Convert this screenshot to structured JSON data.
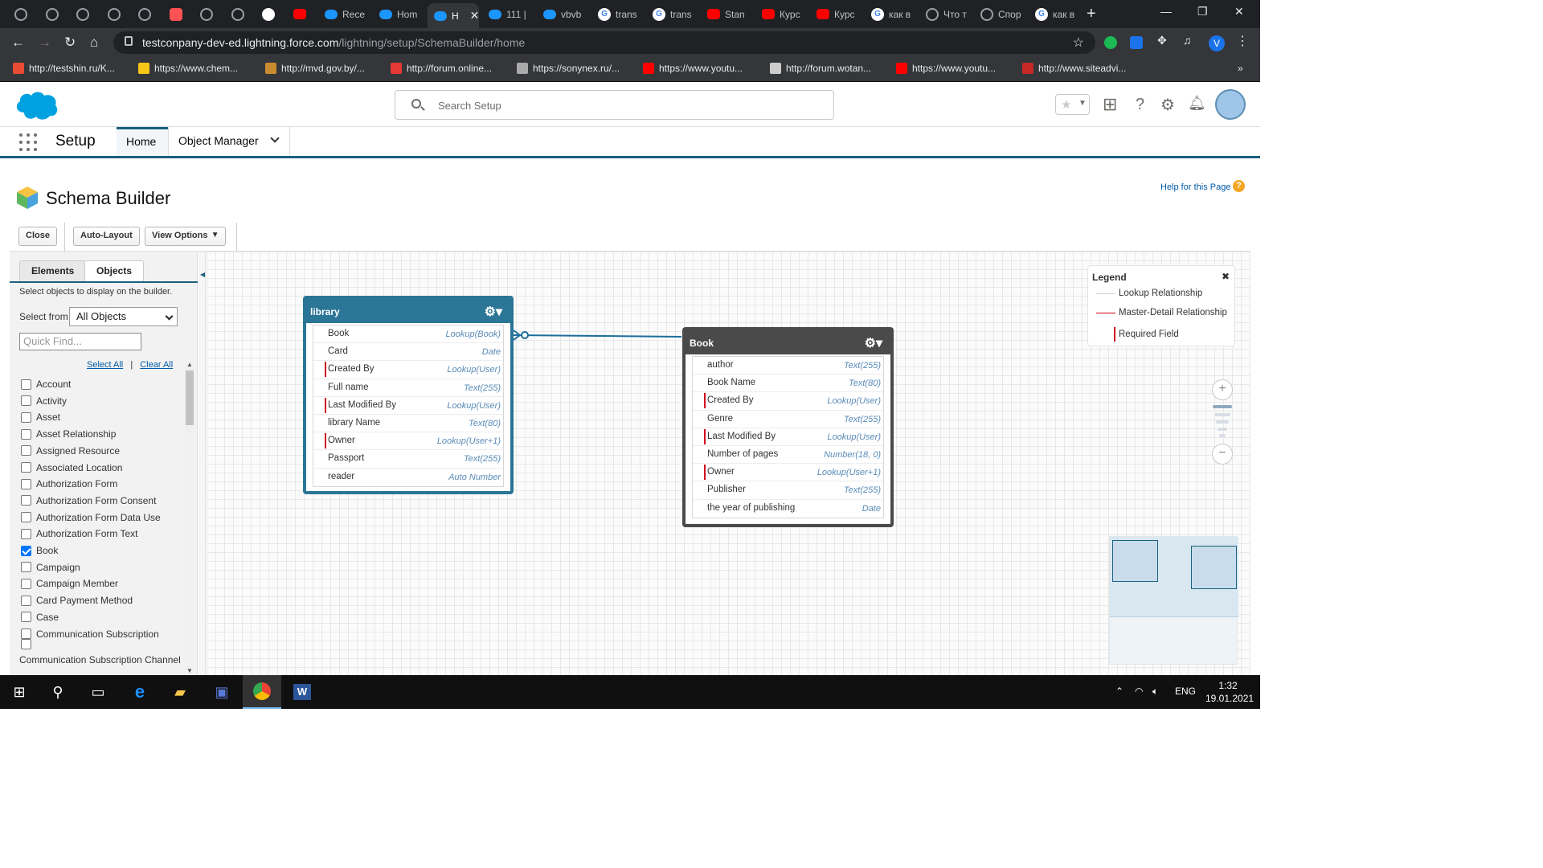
{
  "browser": {
    "tabs": [
      {
        "label": "",
        "icon": "globe-icon"
      },
      {
        "label": "",
        "icon": "globe-icon"
      },
      {
        "label": "",
        "icon": "globe-icon"
      },
      {
        "label": "",
        "icon": "globe-icon"
      },
      {
        "label": "",
        "icon": "globe-icon"
      },
      {
        "label": "",
        "icon": "chat-icon"
      },
      {
        "label": "",
        "icon": "globe-icon"
      },
      {
        "label": "",
        "icon": "globe-icon"
      },
      {
        "label": "",
        "icon": "github-icon"
      },
      {
        "label": "",
        "icon": "youtube-icon"
      },
      {
        "label": "Rece",
        "icon": "salesforce-icon"
      },
      {
        "label": "Hom",
        "icon": "salesforce-icon"
      },
      {
        "label": "H",
        "icon": "salesforce-icon",
        "active": true
      },
      {
        "label": "111 |",
        "icon": "salesforce-icon"
      },
      {
        "label": "vbvb",
        "icon": "salesforce-icon"
      },
      {
        "label": "trans",
        "icon": "google-icon"
      },
      {
        "label": "trans",
        "icon": "google-icon"
      },
      {
        "label": "Stan",
        "icon": "youtube-icon"
      },
      {
        "label": "Курс",
        "icon": "youtube-icon"
      },
      {
        "label": "Курс",
        "icon": "youtube-icon"
      },
      {
        "label": "как в",
        "icon": "google-icon"
      },
      {
        "label": "Что т",
        "icon": "globe-icon"
      },
      {
        "label": "Спор",
        "icon": "globe-icon"
      },
      {
        "label": "как в",
        "icon": "google-icon"
      }
    ],
    "url_host": "testconpany-dev-ed.lightning.force.com",
    "url_path": "/lightning/setup/SchemaBuilder/home",
    "profile_initial": "V",
    "bookmarks": [
      "http://testshin.ru/K...",
      "https://www.chem...",
      "http://mvd.gov.by/...",
      "http://forum.online...",
      "https://sonynex.ru/...",
      "https://www.youtu...",
      "http://forum.wotan...",
      "https://www.youtu...",
      "http://www.siteadvi..."
    ],
    "more_bookmarks": "»"
  },
  "sf_header": {
    "search_placeholder": "Search Setup"
  },
  "context": {
    "app_name": "Setup",
    "tab_home": "Home",
    "tab_object_manager": "Object Manager"
  },
  "page": {
    "title": "Schema Builder",
    "help_link": "Help for this Page",
    "help_q": "?",
    "buttons": {
      "close": "Close",
      "auto_layout": "Auto-Layout",
      "view_options": "View Options"
    }
  },
  "left_panel": {
    "tab_elements": "Elements",
    "tab_objects": "Objects",
    "hint": "Select objects to display on the builder.",
    "select_from_label": "Select from",
    "select_value": "All Objects",
    "quick_find_placeholder": "Quick Find...",
    "select_all": "Select All",
    "separator": "|",
    "clear_all": "Clear All",
    "objects": [
      {
        "name": "Account",
        "checked": false
      },
      {
        "name": "Activity",
        "checked": false
      },
      {
        "name": "Asset",
        "checked": false
      },
      {
        "name": "Asset Relationship",
        "checked": false
      },
      {
        "name": "Assigned Resource",
        "checked": false
      },
      {
        "name": "Associated Location",
        "checked": false
      },
      {
        "name": "Authorization Form",
        "checked": false
      },
      {
        "name": "Authorization Form Consent",
        "checked": false
      },
      {
        "name": "Authorization Form Data Use",
        "checked": false
      },
      {
        "name": "Authorization Form Text",
        "checked": false
      },
      {
        "name": "Book",
        "checked": true
      },
      {
        "name": "Campaign",
        "checked": false
      },
      {
        "name": "Campaign Member",
        "checked": false
      },
      {
        "name": "Card Payment Method",
        "checked": false
      },
      {
        "name": "Case",
        "checked": false
      },
      {
        "name": "Communication Subscription",
        "checked": false
      },
      {
        "name": "Communication Subscription Channel T",
        "checked": false
      }
    ]
  },
  "schema": {
    "library": {
      "title": "library",
      "color": "#2b7596",
      "fields": [
        {
          "name": "Book",
          "type": "Lookup(Book)",
          "required": false
        },
        {
          "name": "Card",
          "type": "Date",
          "required": false
        },
        {
          "name": "Created By",
          "type": "Lookup(User)",
          "required": true
        },
        {
          "name": "Full name",
          "type": "Text(255)",
          "required": false
        },
        {
          "name": "Last Modified By",
          "type": "Lookup(User)",
          "required": true
        },
        {
          "name": "library Name",
          "type": "Text(80)",
          "required": false
        },
        {
          "name": "Owner",
          "type": "Lookup(User+1)",
          "required": true
        },
        {
          "name": "Passport",
          "type": "Text(255)",
          "required": false
        },
        {
          "name": "reader",
          "type": "Auto Number",
          "required": false
        }
      ]
    },
    "book": {
      "title": "Book",
      "color": "#4a4a4a",
      "fields": [
        {
          "name": "author",
          "type": "Text(255)",
          "required": false
        },
        {
          "name": "Book Name",
          "type": "Text(80)",
          "required": false
        },
        {
          "name": "Created By",
          "type": "Lookup(User)",
          "required": true
        },
        {
          "name": "Genre",
          "type": "Text(255)",
          "required": false
        },
        {
          "name": "Last Modified By",
          "type": "Lookup(User)",
          "required": true
        },
        {
          "name": "Number of pages",
          "type": "Number(18, 0)",
          "required": false
        },
        {
          "name": "Owner",
          "type": "Lookup(User+1)",
          "required": true
        },
        {
          "name": "Publisher",
          "type": "Text(255)",
          "required": false
        },
        {
          "name": "the year of publishing",
          "type": "Date",
          "required": false
        }
      ]
    },
    "legend": {
      "title": "Legend",
      "close": "✖",
      "lookup": "Lookup Relationship",
      "master_detail": "Master-Detail Relationship",
      "required": "Required Field",
      "lookup_color": "#c8d3dc",
      "master_color": "#d0021b",
      "required_color": "#d0021b"
    },
    "zoom": {
      "plus": "+",
      "minus": "−"
    }
  },
  "taskbar": {
    "lang": "ENG",
    "time": "1:32",
    "date": "19.01.2021"
  }
}
